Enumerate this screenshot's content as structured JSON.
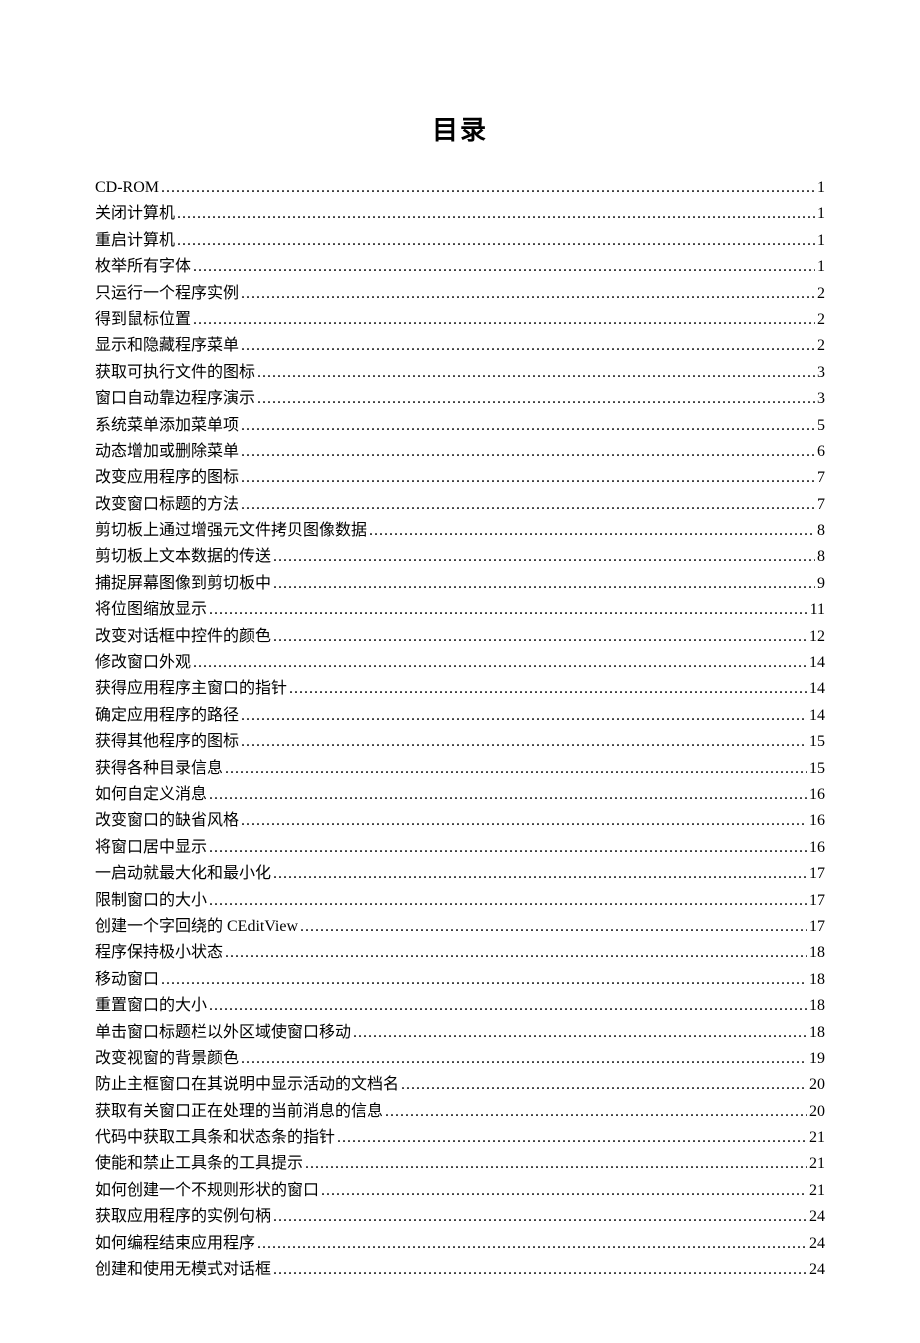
{
  "title": "目录",
  "entries": [
    {
      "label": "CD-ROM",
      "page": "1"
    },
    {
      "label": "关闭计算机",
      "page": "1"
    },
    {
      "label": "重启计算机",
      "page": "1"
    },
    {
      "label": "枚举所有字体",
      "page": "1"
    },
    {
      "label": "只运行一个程序实例",
      "page": "2"
    },
    {
      "label": "得到鼠标位置",
      "page": "2"
    },
    {
      "label": "显示和隐藏程序菜单",
      "page": "2"
    },
    {
      "label": "获取可执行文件的图标",
      "page": "3"
    },
    {
      "label": "窗口自动靠边程序演示",
      "page": "3"
    },
    {
      "label": "系统菜单添加菜单项",
      "page": "5"
    },
    {
      "label": "动态增加或删除菜单",
      "page": "6"
    },
    {
      "label": "改变应用程序的图标",
      "page": "7"
    },
    {
      "label": "改变窗口标题的方法",
      "page": "7"
    },
    {
      "label": "剪切板上通过增强元文件拷贝图像数据",
      "page": "8"
    },
    {
      "label": "剪切板上文本数据的传送",
      "page": "8"
    },
    {
      "label": "捕捉屏幕图像到剪切板中",
      "page": "9"
    },
    {
      "label": "将位图缩放显示",
      "page": "11"
    },
    {
      "label": "改变对话框中控件的颜色",
      "page": "12"
    },
    {
      "label": "修改窗口外观",
      "page": "14"
    },
    {
      "label": "获得应用程序主窗口的指针",
      "page": "14"
    },
    {
      "label": "确定应用程序的路径",
      "page": "14"
    },
    {
      "label": "获得其他程序的图标",
      "page": "15"
    },
    {
      "label": "获得各种目录信息",
      "page": "15"
    },
    {
      "label": "如何自定义消息",
      "page": "16"
    },
    {
      "label": "改变窗口的缺省风格",
      "page": "16"
    },
    {
      "label": "将窗口居中显示",
      "page": "16"
    },
    {
      "label": "一启动就最大化和最小化",
      "page": "17"
    },
    {
      "label": "限制窗口的大小",
      "page": "17"
    },
    {
      "label": "创建一个字回绕的 CEditView",
      "page": "17"
    },
    {
      "label": "程序保持极小状态",
      "page": "18"
    },
    {
      "label": "移动窗口",
      "page": "18"
    },
    {
      "label": "重置窗口的大小",
      "page": "18"
    },
    {
      "label": "单击窗口标题栏以外区域使窗口移动",
      "page": "18"
    },
    {
      "label": "改变视窗的背景颜色",
      "page": "19"
    },
    {
      "label": "防止主框窗口在其说明中显示活动的文档名",
      "page": "20"
    },
    {
      "label": "获取有关窗口正在处理的当前消息的信息",
      "page": "20"
    },
    {
      "label": "代码中获取工具条和状态条的指针",
      "page": "21"
    },
    {
      "label": "使能和禁止工具条的工具提示",
      "page": "21"
    },
    {
      "label": "如何创建一个不规则形状的窗口",
      "page": "21"
    },
    {
      "label": "获取应用程序的实例句柄",
      "page": "24"
    },
    {
      "label": "如何编程结束应用程序",
      "page": "24"
    },
    {
      "label": "创建和使用无模式对话框",
      "page": "24"
    }
  ]
}
